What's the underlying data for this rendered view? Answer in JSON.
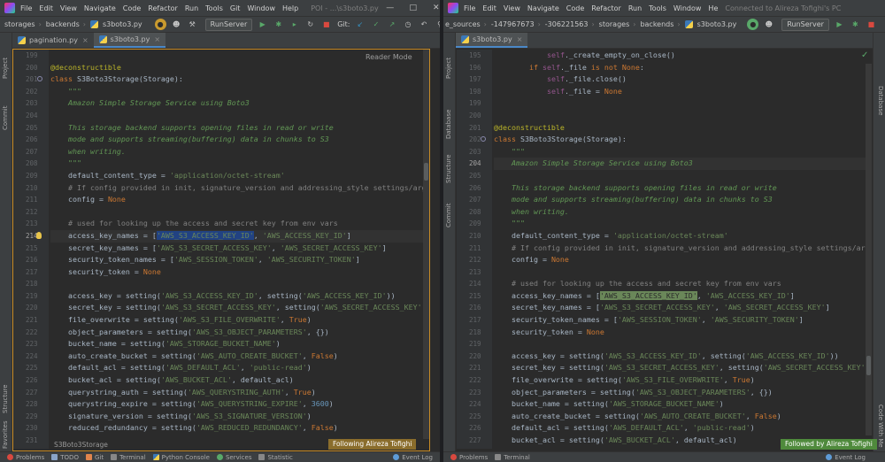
{
  "left_window": {
    "menu": [
      "File",
      "Edit",
      "View",
      "Navigate",
      "Code",
      "Refactor",
      "Run",
      "Tools",
      "Git",
      "Window",
      "Help"
    ],
    "title": "POI - ...\\s3boto3.py",
    "breadcrumbs": [
      "storages",
      "backends",
      "s3boto3.py"
    ],
    "run_config": "RunServer",
    "git_label": "Git:",
    "tabs": [
      {
        "label": "pagination.py",
        "active": false
      },
      {
        "label": "s3boto3.py",
        "active": true
      }
    ],
    "left_stripe_labels": [
      "Project",
      "Commit"
    ],
    "left_stripe_bottom": [
      "Structure",
      "Favorites"
    ],
    "reader_mode": "Reader Mode",
    "gutter": [
      "199",
      "200",
      "201",
      "202",
      "203",
      "204",
      "205",
      "206",
      "207",
      "208",
      "209",
      "210",
      "211",
      "212",
      "213",
      "214",
      "215",
      "216",
      "217",
      "218",
      "219",
      "220",
      "221",
      "222",
      "223",
      "224",
      "225",
      "226",
      "227",
      "228",
      "229",
      "230",
      "231"
    ],
    "code_lines": [
      "",
      "@deconstructible",
      "class S3Boto3Storage(Storage):",
      "    \"\"\"",
      "    Amazon Simple Storage Service using Boto3",
      "",
      "    This storage backend supports opening files in read or write",
      "    mode and supports streaming(buffering) data in chunks to S3",
      "    when writing.",
      "    \"\"\"",
      "    default_content_type = 'application/octet-stream'",
      "    # If config provided in init, signature_version and addressing_style settings/args are ignored.",
      "    config = None",
      "",
      "    # used for looking up the access and secret key from env vars",
      "    access_key_names = ['AWS_S3_ACCESS_KEY_ID', 'AWS_ACCESS_KEY_ID']",
      "    secret_key_names = ['AWS_S3_SECRET_ACCESS_KEY', 'AWS_SECRET_ACCESS_KEY']",
      "    security_token_names = ['AWS_SESSION_TOKEN', 'AWS_SECURITY_TOKEN']",
      "    security_token = None",
      "",
      "    access_key = setting('AWS_S3_ACCESS_KEY_ID', setting('AWS_ACCESS_KEY_ID'))",
      "    secret_key = setting('AWS_S3_SECRET_ACCESS_KEY', setting('AWS_SECRET_ACCESS_KEY'))",
      "    file_overwrite = setting('AWS_S3_FILE_OVERWRITE', True)",
      "    object_parameters = setting('AWS_S3_OBJECT_PARAMETERS', {})",
      "    bucket_name = setting('AWS_STORAGE_BUCKET_NAME')",
      "    auto_create_bucket = setting('AWS_AUTO_CREATE_BUCKET', False)",
      "    default_acl = setting('AWS_DEFAULT_ACL', 'public-read')",
      "    bucket_acl = setting('AWS_BUCKET_ACL', default_acl)",
      "    querystring_auth = setting('AWS_QUERYSTRING_AUTH', True)",
      "    querystring_expire = setting('AWS_QUERYSTRING_EXPIRE', 3600)",
      "    signature_version = setting('AWS_S3_SIGNATURE_VERSION')",
      "    reduced_redundancy = setting('AWS_REDUCED_REDUNDANCY', False)",
      ""
    ],
    "code_breadcrumb": "S3Boto3Storage",
    "follow_badge": "Following Alireza Tofighi",
    "status": [
      "Problems",
      "TODO",
      "Git",
      "Terminal",
      "Python Console",
      "Services",
      "Statistic"
    ],
    "event_log": "Event Log"
  },
  "right_window": {
    "menu": [
      "File",
      "Edit",
      "View",
      "Navigate",
      "Code",
      "Refactor",
      "Run",
      "Tools",
      "Window",
      "He"
    ],
    "title": "Connected to Alireza Tofighi's PC",
    "breadcrumbs": [
      "e_sources",
      "-147967673",
      "-306221563",
      "storages",
      "backends",
      "s3boto3.py"
    ],
    "run_config": "RunServer",
    "tabs": [
      {
        "label": "s3boto3.py",
        "active": true
      }
    ],
    "left_stripe_labels": [
      "Project",
      "Database",
      "Structure",
      "Commit"
    ],
    "right_stripe_labels": [
      "Database",
      "Code With Me"
    ],
    "gutter": [
      "195",
      "196",
      "197",
      "198",
      "199",
      "200",
      "201",
      "202",
      "203",
      "204",
      "205",
      "206",
      "207",
      "208",
      "209",
      "210",
      "211",
      "212",
      "213",
      "214",
      "215",
      "216",
      "217",
      "218",
      "219",
      "220",
      "221",
      "222",
      "223",
      "224",
      "225",
      "226",
      "227"
    ],
    "code_lines": [
      "            self._create_empty_on_close()",
      "        if self._file is not None:",
      "            self._file.close()",
      "            self._file = None",
      "",
      "",
      "@deconstructible",
      "class S3Boto3Storage(Storage):",
      "    \"\"\"",
      "    Amazon Simple Storage Service using Boto3",
      "",
      "    This storage backend supports opening files in read or write",
      "    mode and supports streaming(buffering) data in chunks to S3",
      "    when writing.",
      "    \"\"\"",
      "    default_content_type = 'application/octet-stream'",
      "    # If config provided in init, signature_version and addressing_style settings/args are ignored.",
      "    config = None",
      "",
      "    # used for looking up the access and secret key from env vars",
      "    access_key_names = ['AWS_S3_ACCESS_KEY_ID', 'AWS_ACCESS_KEY_ID']",
      "    secret_key_names = ['AWS_S3_SECRET_ACCESS_KEY', 'AWS_SECRET_ACCESS_KEY']",
      "    security_token_names = ['AWS_SESSION_TOKEN', 'AWS_SECURITY_TOKEN']",
      "    security_token = None",
      "",
      "    access_key = setting('AWS_S3_ACCESS_KEY_ID', setting('AWS_ACCESS_KEY_ID'))",
      "    secret_key = setting('AWS_S3_SECRET_ACCESS_KEY', setting('AWS_SECRET_ACCESS_KEY'))",
      "    file_overwrite = setting('AWS_S3_FILE_OVERWRITE', True)",
      "    object_parameters = setting('AWS_S3_OBJECT_PARAMETERS', {})",
      "    bucket_name = setting('AWS_STORAGE_BUCKET_NAME')",
      "    auto_create_bucket = setting('AWS_AUTO_CREATE_BUCKET', False)",
      "    default_acl = setting('AWS_DEFAULT_ACL', 'public-read')",
      "    bucket_acl = setting('AWS_BUCKET_ACL', default_acl)"
    ],
    "follow_badge": "Followed by Alireza Tofighi",
    "status": [
      "Problems",
      "Terminal"
    ],
    "event_log": "Event Log"
  }
}
